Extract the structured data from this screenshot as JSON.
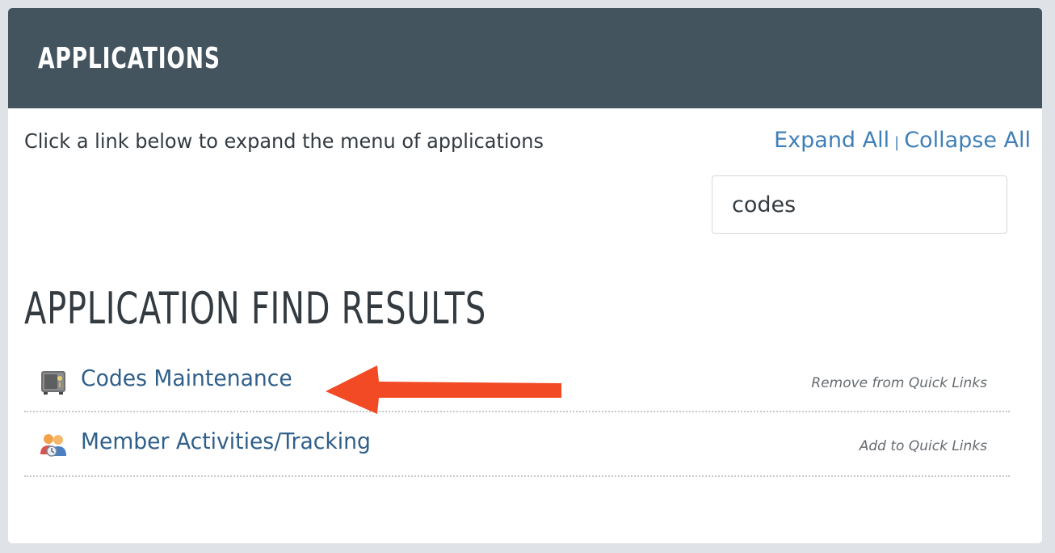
{
  "header": {
    "title": "APPLICATIONS"
  },
  "instructions": "Click a link below to expand the menu of applications",
  "controls": {
    "expand_all": "Expand All",
    "separator": "|",
    "collapse_all": "Collapse All"
  },
  "search": {
    "value": "codes"
  },
  "results": {
    "title": "APPLICATION FIND RESULTS",
    "items": [
      {
        "label": "Codes Maintenance",
        "icon": "safe-icon",
        "quick_link": "Remove from Quick Links"
      },
      {
        "label": "Member Activities/Tracking",
        "icon": "members-icon",
        "quick_link": "Add to Quick Links"
      }
    ]
  },
  "colors": {
    "header_bg": "#44545f",
    "link": "#3f7fb7",
    "result_link": "#2f5f8a",
    "arrow": "#f24a24"
  }
}
